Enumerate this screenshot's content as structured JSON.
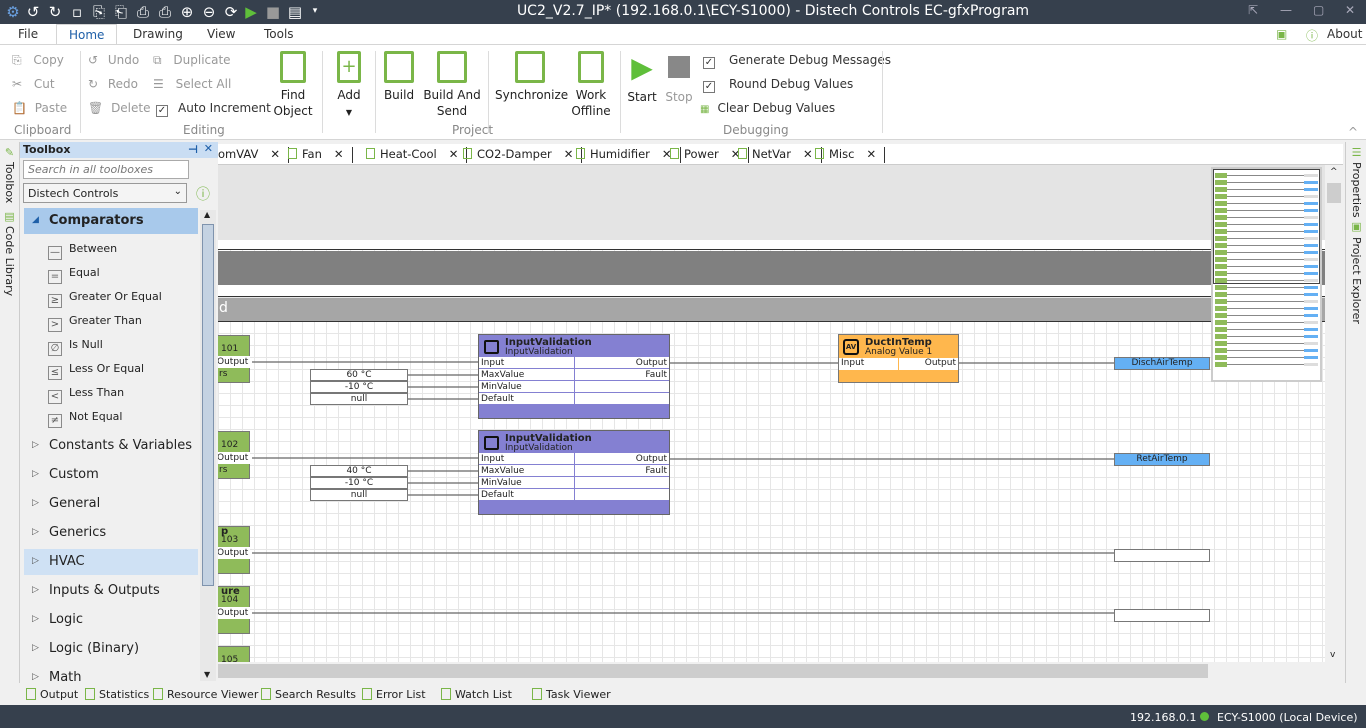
{
  "title": "UC2_V2.7_IP* (192.168.0.1\\ECY-S1000) - Distech Controls EC-gfxProgram",
  "quick_access": [
    "app-logo-icon",
    "undo-icon",
    "redo-icon",
    "save-icon",
    "import-icon",
    "export-icon",
    "print-preview-icon",
    "print-icon",
    "zoom-in-icon",
    "zoom-out-icon",
    "refresh-icon",
    "start-icon",
    "stop-icon",
    "layout-icon",
    "dropdown-icon"
  ],
  "menu": {
    "file": "File",
    "tabs": [
      "Home",
      "Drawing",
      "View",
      "Tools"
    ],
    "about": "About"
  },
  "ribbon": {
    "clipboard": {
      "label": "Clipboard",
      "copy": "Copy",
      "cut": "Cut",
      "paste": "Paste"
    },
    "editing": {
      "label": "Editing",
      "undo": "Undo",
      "redo": "Redo",
      "delete": "Delete",
      "duplicate": "Duplicate",
      "select_all": "Select All",
      "auto_increment": "Auto Increment",
      "find_object_1": "Find",
      "find_object_2": "Object"
    },
    "project": {
      "label": "Project",
      "add": "Add",
      "build": "Build",
      "build_send_1": "Build And",
      "build_send_2": "Send",
      "synchronize": "Synchronize",
      "work_offline_1": "Work",
      "work_offline_2": "Offline"
    },
    "debugging": {
      "label": "Debugging",
      "start": "Start",
      "stop": "Stop",
      "generate": "Generate Debug Messages",
      "round": "Round Debug Values",
      "clear": "Clear Debug Values"
    }
  },
  "side_tabs": {
    "toolbox": "Toolbox",
    "code_library": "Code Library",
    "properties": "Properties",
    "project_explorer": "Project Explorer"
  },
  "toolbox": {
    "title": "Toolbox",
    "search_placeholder": "Search in all toolboxes",
    "selected_library": "Distech Controls",
    "expanded": "Comparators",
    "items": [
      {
        "label": "Between",
        "glyph": "—"
      },
      {
        "label": "Equal",
        "glyph": "="
      },
      {
        "label": "Greater Or Equal",
        "glyph": "≥"
      },
      {
        "label": "Greater Than",
        "glyph": ">"
      },
      {
        "label": "Is Null",
        "glyph": "∅"
      },
      {
        "label": "Less Or Equal",
        "glyph": "≤"
      },
      {
        "label": "Less Than",
        "glyph": "<"
      },
      {
        "label": "Not Equal",
        "glyph": "≠"
      }
    ],
    "categories": [
      "Constants & Variables",
      "Custom",
      "General",
      "Generics",
      "HVAC",
      "Inputs & Outputs",
      "Logic",
      "Logic (Binary)",
      "Math"
    ]
  },
  "doc_tabs": [
    "omVAV",
    "Fan",
    "Heat-Cool",
    "CO2-Damper",
    "Humidifier",
    "Power",
    "NetVar",
    "Misc"
  ],
  "canvas": {
    "band_label": "d",
    "inputs": [
      {
        "line1": "",
        "line2": "101",
        "port": "Output",
        "extra": "rs"
      },
      {
        "line1": "",
        "line2": "102",
        "port": "Output",
        "extra": "rs"
      },
      {
        "line1": "p",
        "line2": "103",
        "port": "Output",
        "extra": ""
      },
      {
        "line1": "ure",
        "line2": "104",
        "port": "Output",
        "extra": ""
      },
      {
        "line1": "",
        "line2": "105",
        "port": "",
        "extra": ""
      }
    ],
    "validations": [
      {
        "title": "InputValidation",
        "subtitle": "InputValidation",
        "ports_in": [
          "Input",
          "MaxValue",
          "MinValue",
          "Default"
        ],
        "ports_out": [
          "Output",
          "Fault"
        ],
        "constants": [
          "60 °C",
          "-10 °C",
          "null"
        ]
      },
      {
        "title": "InputValidation",
        "subtitle": "InputValidation",
        "ports_in": [
          "Input",
          "MaxValue",
          "MinValue",
          "Default"
        ],
        "ports_out": [
          "Output",
          "Fault"
        ],
        "constants": [
          "40 °C",
          "-10 °C",
          "null"
        ]
      }
    ],
    "analog_value": {
      "title": "DuctInTemp",
      "subtitle": "Analog Value 1",
      "icon": "AV",
      "in": "Input",
      "out": "Output"
    },
    "tags": [
      "DischAirTemp",
      "RetAirTemp",
      "",
      ""
    ]
  },
  "bottom_tabs": [
    "Output",
    "Statistics",
    "Resource Viewer",
    "Search Results",
    "Error List",
    "Watch List",
    "Task Viewer"
  ],
  "status": {
    "ip": "192.168.0.1",
    "device": "ECY-S1000 (Local Device)",
    "connected_color": "#5fbf3a"
  },
  "colors": {
    "accent_green": "#7ab648",
    "titlebar": "#36404d",
    "block_purple": "#8480d2",
    "block_orange": "#ffb74d",
    "tag_blue": "#64b0f4"
  }
}
